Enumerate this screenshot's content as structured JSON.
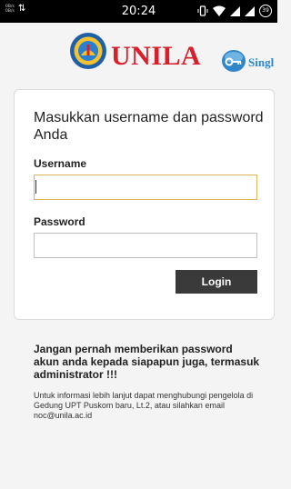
{
  "status_bar": {
    "net_speed_top": "0B/s",
    "net_speed_bottom": "0B/s",
    "time": "20:24",
    "battery": "39"
  },
  "header": {
    "brand": "UNILA",
    "sso_text": "Singl"
  },
  "login_card": {
    "title": "Masukkan username dan password Anda",
    "username_label": "Username",
    "username_value": "",
    "password_label": "Password",
    "password_value": "",
    "login_button": "Login"
  },
  "notice": {
    "warning": "Jangan pernah memberikan password akun anda kepada siapapun juga, termasuk administrator !!!",
    "info": "Untuk informasi lebih lanjut dapat menghubungi pengelola di Gedung UPT Puskom baru, Lt.2, atau silahkan email noc@unila.ac.id"
  },
  "colors": {
    "brand_red": "#d8202c",
    "sso_blue": "#2f86c9",
    "button_dark": "#3a3a3a",
    "focus_border": "#e0b35a"
  }
}
